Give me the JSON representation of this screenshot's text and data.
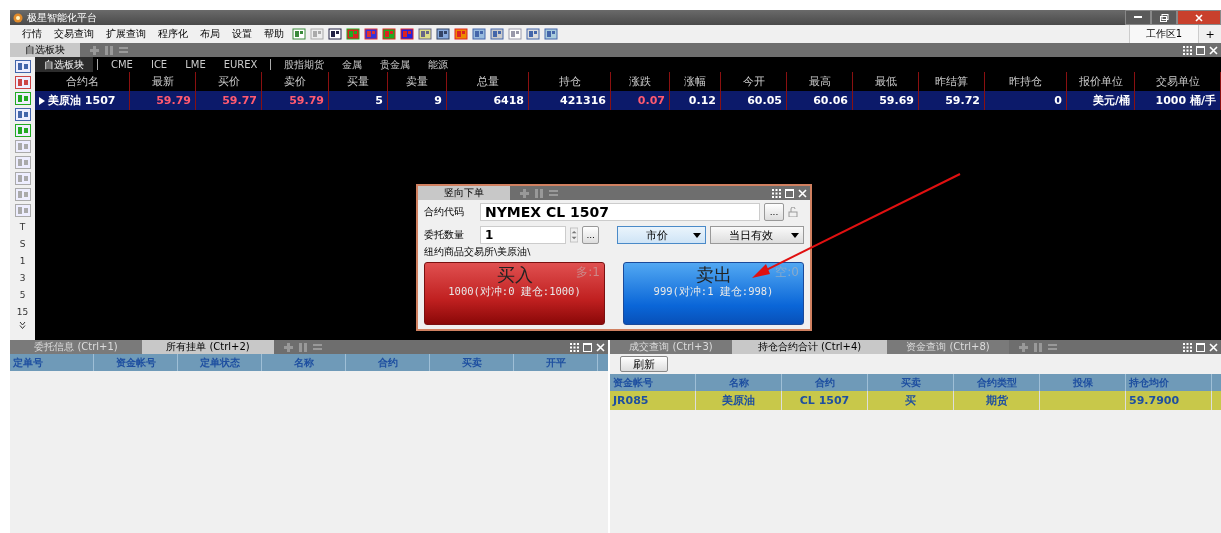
{
  "window": {
    "title": "极星智能化平台"
  },
  "menu": [
    "行情",
    "交易查询",
    "扩展查询",
    "程序化",
    "布局",
    "设置",
    "帮助"
  ],
  "workspace_tabs": [
    {
      "label": "工作区1",
      "selected": true
    }
  ],
  "add_tab": "+",
  "quote_panel": {
    "tab": "自选板块",
    "market_tabs": [
      {
        "label": "自选板块",
        "selected": true
      },
      {
        "label": "CME",
        "selected": false
      },
      {
        "label": "ICE",
        "selected": false
      },
      {
        "label": "LME",
        "selected": false
      },
      {
        "label": "EUREX",
        "selected": false
      },
      {
        "label": "股指期货",
        "selected": false
      },
      {
        "label": "金属",
        "selected": false
      },
      {
        "label": "贵金属",
        "selected": false
      },
      {
        "label": "能源",
        "selected": false
      }
    ],
    "columns": [
      "合约名",
      "最新",
      "买价",
      "卖价",
      "买量",
      "卖量",
      "总量",
      "持仓",
      "涨跌",
      "涨幅",
      "今开",
      "最高",
      "最低",
      "昨结算",
      "昨持仓",
      "报价单位",
      "交易单位"
    ],
    "rows": [
      {
        "selected": true,
        "cells": [
          {
            "text": "美原油 1507",
            "rising": false
          },
          {
            "text": "59.79",
            "rising": true
          },
          {
            "text": "59.77",
            "rising": true
          },
          {
            "text": "59.79",
            "rising": true
          },
          {
            "text": "5",
            "rising": false
          },
          {
            "text": "9",
            "rising": false
          },
          {
            "text": "6418",
            "rising": false
          },
          {
            "text": "421316",
            "rising": false
          },
          {
            "text": "0.07",
            "rising": true
          },
          {
            "text": "0.12",
            "rising": false
          },
          {
            "text": "60.05",
            "rising": false
          },
          {
            "text": "60.06",
            "rising": false
          },
          {
            "text": "59.69",
            "rising": false
          },
          {
            "text": "59.72",
            "rising": false
          },
          {
            "text": "0",
            "rising": false
          },
          {
            "text": "美元/桶",
            "rising": false
          },
          {
            "text": "1000 桶/手",
            "rising": false
          }
        ]
      }
    ]
  },
  "side_toolbar": {
    "labels": [
      "T",
      "S",
      "1",
      "3",
      "5",
      "15"
    ]
  },
  "order_dialog": {
    "title": "竖向下单",
    "contract_label": "合约代码",
    "contract": "NYMEX CL 1507",
    "browse": "...",
    "qty_label": "委托数量",
    "qty": "1",
    "qty_browse": "...",
    "price_type": {
      "value": "市价",
      "focused": true
    },
    "validity": {
      "value": "当日有效",
      "focused": false
    },
    "path": "纽约商品交易所\\美原油\\",
    "buy": {
      "label": "买入",
      "position": "多:1",
      "detail": "1000(对冲:0 建仓:1000)"
    },
    "sell": {
      "label": "卖出",
      "position": "空:0",
      "detail": "999(对冲:1 建仓:998)"
    }
  },
  "bottom_left": {
    "tabs": [
      {
        "label": "委托信息 (Ctrl+1)",
        "selected": false
      },
      {
        "label": "所有挂单 (Ctrl+2)",
        "selected": true
      }
    ],
    "columns": [
      "定单号",
      "资金帐号",
      "定单状态",
      "名称",
      "合约",
      "买卖",
      "开平"
    ]
  },
  "bottom_right": {
    "tabs": [
      {
        "label": "成交查询 (Ctrl+3)",
        "selected": false
      },
      {
        "label": "持仓合约合计 (Ctrl+4)",
        "selected": true
      },
      {
        "label": "资金查询 (Ctrl+8)",
        "selected": false
      }
    ],
    "refresh": "刷新",
    "columns": [
      "资金帐号",
      "名称",
      "合约",
      "买卖",
      "合约类型",
      "投保",
      "持仓均价"
    ],
    "rows": [
      {
        "selected": true,
        "cells": [
          "JR085",
          "美原油",
          "CL 1507",
          "买",
          "期货",
          "",
          "59.7900"
        ]
      }
    ]
  }
}
